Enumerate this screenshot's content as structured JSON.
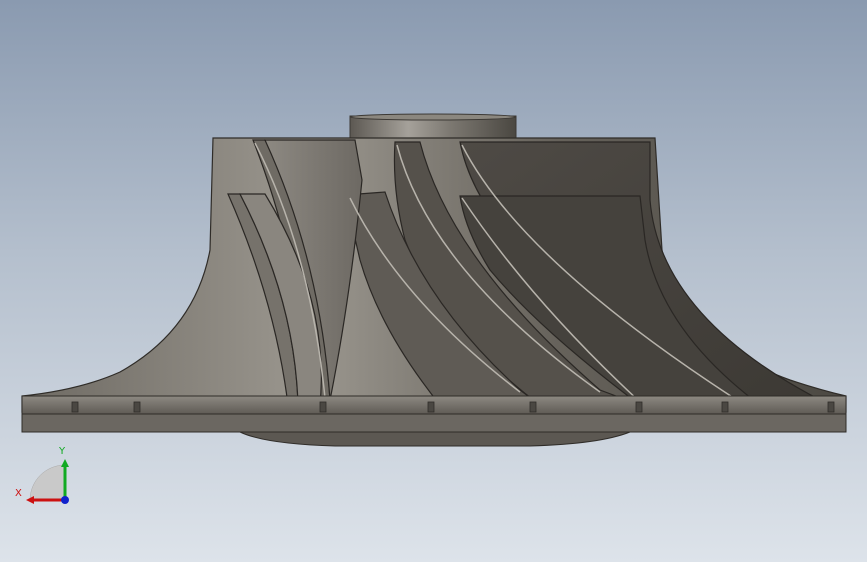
{
  "viewport": {
    "background_top": "#8a9ab0",
    "background_bottom": "#dde3ea"
  },
  "model": {
    "name": "impeller-part",
    "metal_color": "#7a7670"
  },
  "triad": {
    "x_label": "X",
    "y_label": "Y",
    "x_color": "#cc1111",
    "y_color": "#11aa22",
    "z_color": "#1122cc"
  }
}
